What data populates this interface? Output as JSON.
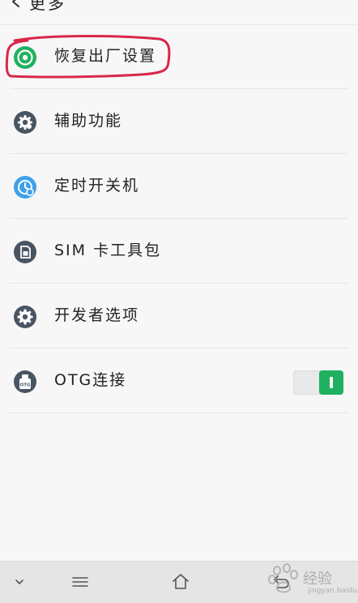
{
  "header": {
    "title": "更多"
  },
  "items": [
    {
      "label": "恢复出厂设置",
      "icon": "restore-icon"
    },
    {
      "label": "辅助功能",
      "icon": "accessibility-gear-icon"
    },
    {
      "label": "定时开关机",
      "icon": "timer-power-icon"
    },
    {
      "label": "SIM 卡工具包",
      "icon": "sim-card-icon"
    },
    {
      "label": "开发者选项",
      "icon": "developer-gear-icon"
    },
    {
      "label": "OTG连接",
      "icon": "otg-icon"
    }
  ],
  "otg_toggle": {
    "state": "on"
  },
  "colors": {
    "icon_dark": "#4a5563",
    "icon_blue": "#3ea1ea",
    "icon_green": "#1fb15f",
    "highlight_red": "#d8274a",
    "toggle_green": "#1fb15f"
  },
  "navbar": {
    "items": [
      "collapse-icon",
      "menu-icon",
      "home-icon",
      "back-icon"
    ]
  },
  "watermark": {
    "text": "经验",
    "sub": "jingyan.baidu.com"
  }
}
